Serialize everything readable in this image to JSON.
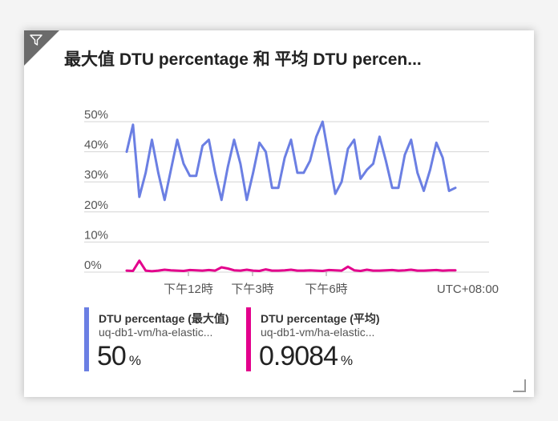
{
  "tile": {
    "title": "最大值 DTU percentage 和 平均 DTU percen..."
  },
  "chart_data": {
    "type": "line",
    "title": "最大值 DTU percentage 和 平均 DTU percen...",
    "y_ticks": [
      "50%",
      "40%",
      "30%",
      "20%",
      "10%",
      "0%"
    ],
    "ylim": [
      0,
      50
    ],
    "x_ticks": [
      "下午12時",
      "下午3時",
      "下午6時"
    ],
    "timezone_label": "UTC+08:00",
    "grid": true,
    "legend_position": "bottom",
    "series": [
      {
        "name": "DTU percentage (最大值)",
        "color": "#6b7fe3",
        "values": [
          40,
          49,
          25,
          33,
          44,
          33,
          24,
          34,
          44,
          36,
          32,
          32,
          42,
          44,
          33,
          24,
          35,
          44,
          36,
          24,
          33,
          43,
          40,
          28,
          28,
          38,
          44,
          33,
          33,
          37,
          45,
          50,
          38,
          26,
          30,
          41,
          44,
          31,
          34,
          36,
          45,
          37,
          28,
          28,
          39,
          44,
          33,
          27,
          34,
          43,
          38,
          27,
          28
        ]
      },
      {
        "name": "DTU percentage (平均)",
        "color": "#e3008c",
        "values": [
          0.5,
          0.4,
          3.8,
          0.5,
          0.3,
          0.5,
          0.8,
          0.6,
          0.5,
          0.4,
          0.7,
          0.6,
          0.5,
          0.7,
          0.5,
          1.6,
          1.2,
          0.6,
          0.5,
          0.8,
          0.5,
          0.4,
          0.9,
          0.5,
          0.5,
          0.6,
          0.8,
          0.5,
          0.5,
          0.6,
          0.5,
          0.4,
          0.7,
          0.6,
          0.5,
          1.8,
          0.6,
          0.4,
          0.8,
          0.5,
          0.5,
          0.6,
          0.7,
          0.5,
          0.6,
          0.8,
          0.5,
          0.5,
          0.6,
          0.7,
          0.5,
          0.6,
          0.6
        ]
      }
    ]
  },
  "legend": [
    {
      "name": "DTU percentage (最大值)",
      "resource": "uq-db1-vm/ha-elastic...",
      "value": "50",
      "unit": "%",
      "color": "#6b7fe3"
    },
    {
      "name": "DTU percentage (平均)",
      "resource": "uq-db1-vm/ha-elastic...",
      "value": "0.9084",
      "unit": "%",
      "color": "#e3008c"
    }
  ]
}
